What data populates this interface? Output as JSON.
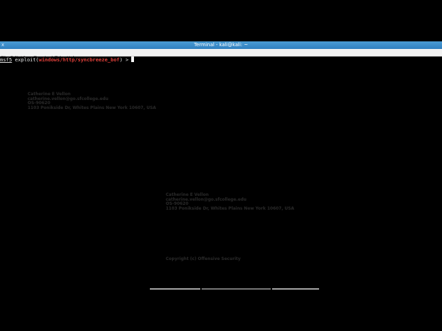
{
  "window": {
    "title": "Terminal - kali@kali: ~",
    "icon_char": "x"
  },
  "menubar": {
    "items": [
      "File",
      "Edit",
      "View",
      "Terminal",
      "Tabs",
      "Help"
    ]
  },
  "terminal": {
    "prompt_prefix": "msf5",
    "command": "exploit(",
    "module": "windows/http/syncbreeze_bof",
    "suffix": ") > "
  },
  "watermarks": {
    "block1": {
      "name": "Catherine E Vellon",
      "email": "catherine.vellon@go.sfcollege.edu",
      "id": "OS-90620",
      "address": "1103 Ponikside Dr, Whites Plains New York 10607, USA"
    },
    "block2": {
      "name": "Catherine E Vellon",
      "email": "catherine.vellon@go.sfcollege.edu",
      "id": "OS-90620",
      "address": "1103 Ponikside Dr, Whites Plains New York 10607, USA"
    },
    "copyright": "Copyright (c) Offensive Security"
  },
  "colors": {
    "titlebar": "#2f7fbf",
    "module_text": "#e0403a",
    "background": "#000000"
  }
}
